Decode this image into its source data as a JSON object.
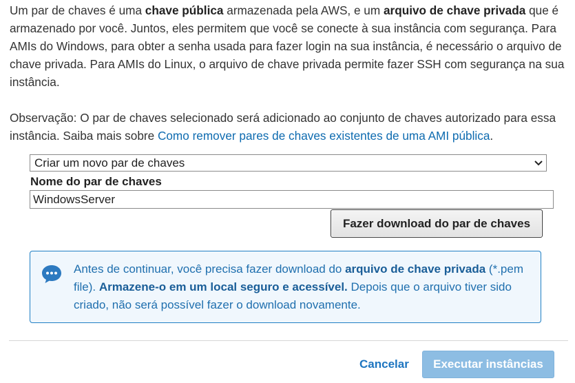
{
  "intro": {
    "t1": "Um par de chaves é uma ",
    "b1": "chave pública",
    "t2": " armazenada pela AWS, e um ",
    "b2": "arquivo de chave privada",
    "t3": " que é armazenado por você. Juntos, eles permitem que você se conecte à sua instância com segurança. Para AMIs do Windows, para obter a senha usada para fazer login na sua instância, é necessário o arquivo de chave privada. Para AMIs do Linux, o arquivo de chave privada permite fazer SSH com segurança na sua instância."
  },
  "note": {
    "text": "Observação: O par de chaves selecionado será adicionado ao conjunto de chaves autorizado para essa instância. Saiba mais sobre ",
    "link": "Como remover pares de chaves existentes de uma AMI pública",
    "end": "."
  },
  "keypair_select": {
    "selected": "Criar um novo par de chaves",
    "icon": "chevron-down-icon"
  },
  "keypair_name": {
    "label": "Nome do par de chaves",
    "value": "WindowsServer"
  },
  "download_button": "Fazer download do par de chaves",
  "info_box": {
    "icon": "chat-bubble-icon",
    "t1": "Antes de continuar, você precisa fazer download do ",
    "b1": "arquivo de chave privada",
    "t2": " (*.pem file). ",
    "b2": "Armazene-o em um local seguro e acessível.",
    "t3": " Depois que o arquivo tiver sido criado, não será possível fazer o download novamente."
  },
  "footer": {
    "cancel": "Cancelar",
    "launch": "Executar instâncias"
  },
  "colors": {
    "link": "#0e6bb0",
    "info_border": "#1f7fc4",
    "info_bg": "#f0f7fd",
    "primary_disabled": "#8dbde3"
  }
}
